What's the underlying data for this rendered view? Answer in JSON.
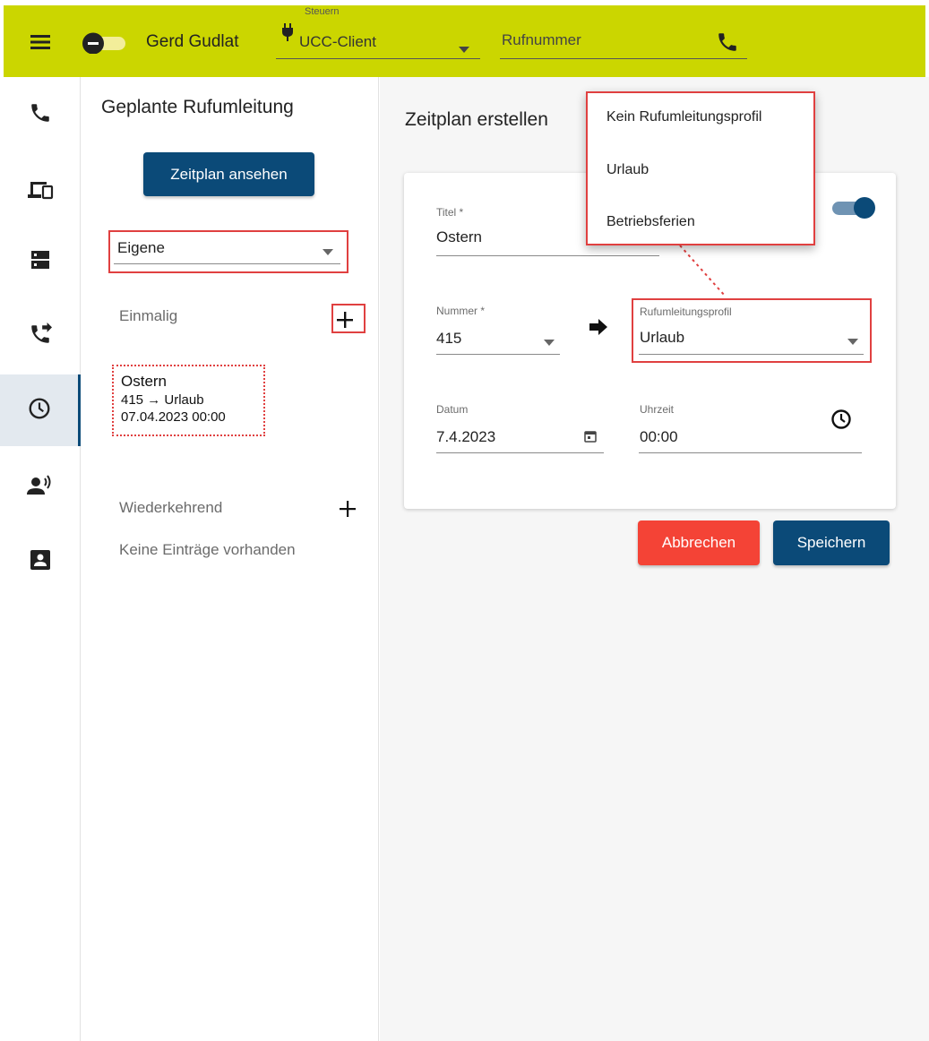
{
  "topbar": {
    "user_name": "Gerd Gudlat",
    "control_label": "Steuern",
    "control_value": "UCC-Client",
    "phone_placeholder": "Rufnummer"
  },
  "sidebar": {
    "items": [
      {
        "name": "phone-icon"
      },
      {
        "name": "devices-icon"
      },
      {
        "name": "server-icon"
      },
      {
        "name": "call-forward-icon"
      },
      {
        "name": "clock-icon",
        "active": true
      },
      {
        "name": "speaking-person-icon"
      },
      {
        "name": "contact-icon"
      }
    ]
  },
  "panel": {
    "title": "Geplante Rufumleitung",
    "view_schedule_button": "Zeitplan ansehen",
    "filter_value": "Eigene",
    "once_section": "Einmalig",
    "entry": {
      "title": "Ostern",
      "route": "415 → Urlaub",
      "datetime": "07.04.2023 00:00"
    },
    "recurring_section": "Wiederkehrend",
    "no_entries": "Keine Einträge vorhanden"
  },
  "main": {
    "title": "Zeitplan erstellen",
    "form": {
      "title_label": "Titel *",
      "title_value": "Ostern",
      "number_label": "Nummer *",
      "number_value": "415",
      "profile_label": "Rufumleitungsprofil",
      "profile_value": "Urlaub",
      "date_label": "Datum",
      "date_value": "7.4.2023",
      "time_label": "Uhrzeit",
      "time_value": "00:00"
    },
    "cancel_button": "Abbrechen",
    "save_button": "Speichern"
  },
  "profile_dropdown": {
    "options": [
      "Kein Rufumleitungsprofil",
      "Urlaub",
      "Betriebsferien"
    ]
  },
  "colors": {
    "accent": "#cbd600",
    "primary": "#0b4a78",
    "danger": "#f44336",
    "highlight": "#e04040"
  }
}
